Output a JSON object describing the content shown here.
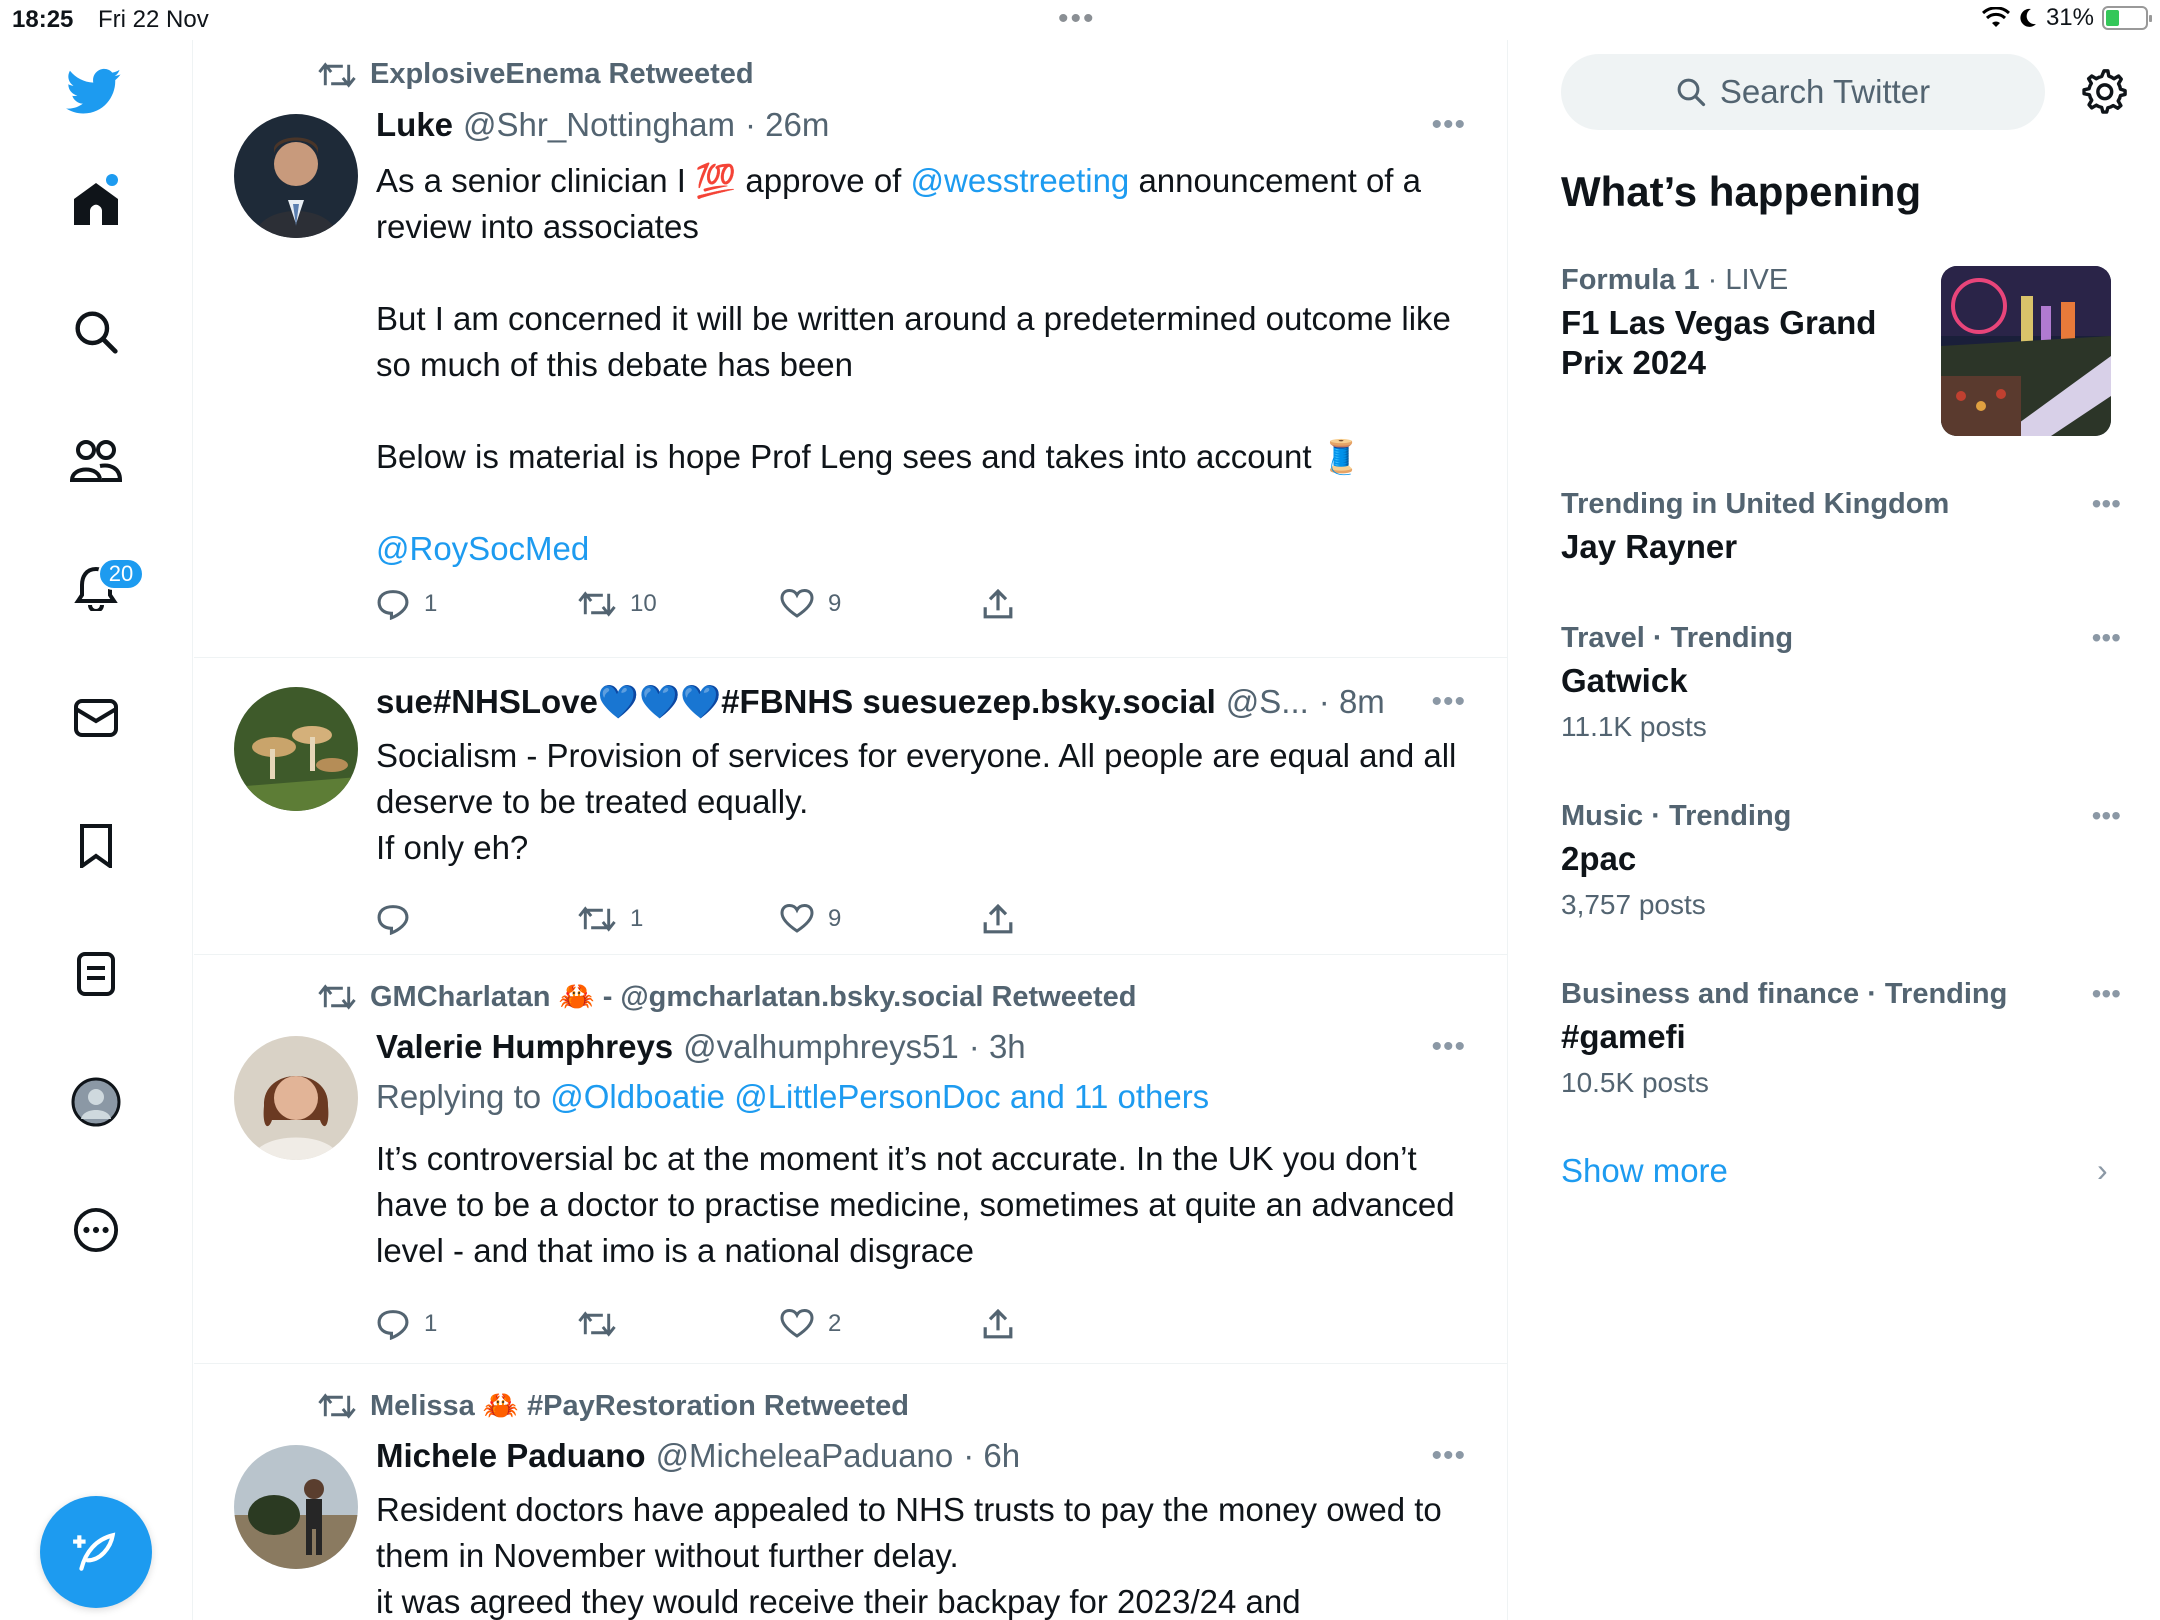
{
  "status_bar": {
    "time": "18:25",
    "date": "Fri 22 Nov",
    "battery": "31%"
  },
  "nav": {
    "notifications_badge": "20"
  },
  "timeline": {
    "tweets": [
      {
        "retweeted_by": "ExplosiveEnema Retweeted",
        "name": "Luke",
        "handle": "@Shr_Nottingham",
        "time": "· 26m",
        "body_1": "As a senior clinician I 💯 approve of ",
        "mention_1": "@wesstreeting",
        "body_2": " announcement of a review into associates\n\nBut I am concerned it will be written around a predetermined outcome like so much of this debate has been\n\nBelow is material is hope Prof Leng sees and takes into account 🧵",
        "mention_2": "@RoySocMed",
        "replies": "1",
        "retweets": "10",
        "likes": "9"
      },
      {
        "name": "sue#NHSLove💙💙💙#FBNHS suesuezep.bsky.social",
        "handle": "@S...",
        "time": "· 8m",
        "body": "Socialism - Provision of services for everyone. All people are equal and all deserve to be treated equally.\nIf only eh?",
        "replies": "",
        "retweets": "1",
        "likes": "9"
      },
      {
        "retweeted_by": "GMCharlatan 🦀 - @gmcharlatan.bsky.social Retweeted",
        "name": "Valerie Humphreys",
        "handle": "@valhumphreys51",
        "time": "· 3h",
        "replying_prefix": "Replying to ",
        "replying_to": "@Oldboatie @LittlePersonDoc and 11 others",
        "body": "It’s controversial bc at the moment it’s not accurate. In the UK you don’t have to be a doctor to practise medicine, sometimes at quite an advanced level - and that imo is a national disgrace",
        "replies": "1",
        "retweets": "",
        "likes": "2"
      },
      {
        "retweeted_by": "Melissa 🦀 #PayRestoration Retweeted",
        "name": "Michele Paduano",
        "handle": "@MicheleaPaduano",
        "time": "· 6h",
        "body": "Resident doctors have appealed to NHS trusts  to pay the money owed to them in November without further delay.\nit was agreed they would receive their backpay for 2023/24 and"
      }
    ]
  },
  "sidebar": {
    "search_placeholder": "Search Twitter",
    "whats_happening": "What’s happening",
    "trends": [
      {
        "category": "Formula 1",
        "sub": " · LIVE",
        "title": "F1 Las Vegas Grand Prix 2024",
        "count": ""
      },
      {
        "category": "Trending in United Kingdom",
        "sub": "",
        "title": "Jay Rayner",
        "count": ""
      },
      {
        "category": "Travel · Trending",
        "sub": "",
        "title": "Gatwick",
        "count": "11.1K posts"
      },
      {
        "category": "Music · Trending",
        "sub": "",
        "title": "2pac",
        "count": "3,757 posts"
      },
      {
        "category": "Business and finance · Trending",
        "sub": "",
        "title": "#gamefi",
        "count": "10.5K posts"
      }
    ],
    "show_more": "Show more"
  },
  "colors": {
    "accent": "#1d9bf0",
    "secondary_text": "#536471",
    "text": "#0f1419"
  }
}
